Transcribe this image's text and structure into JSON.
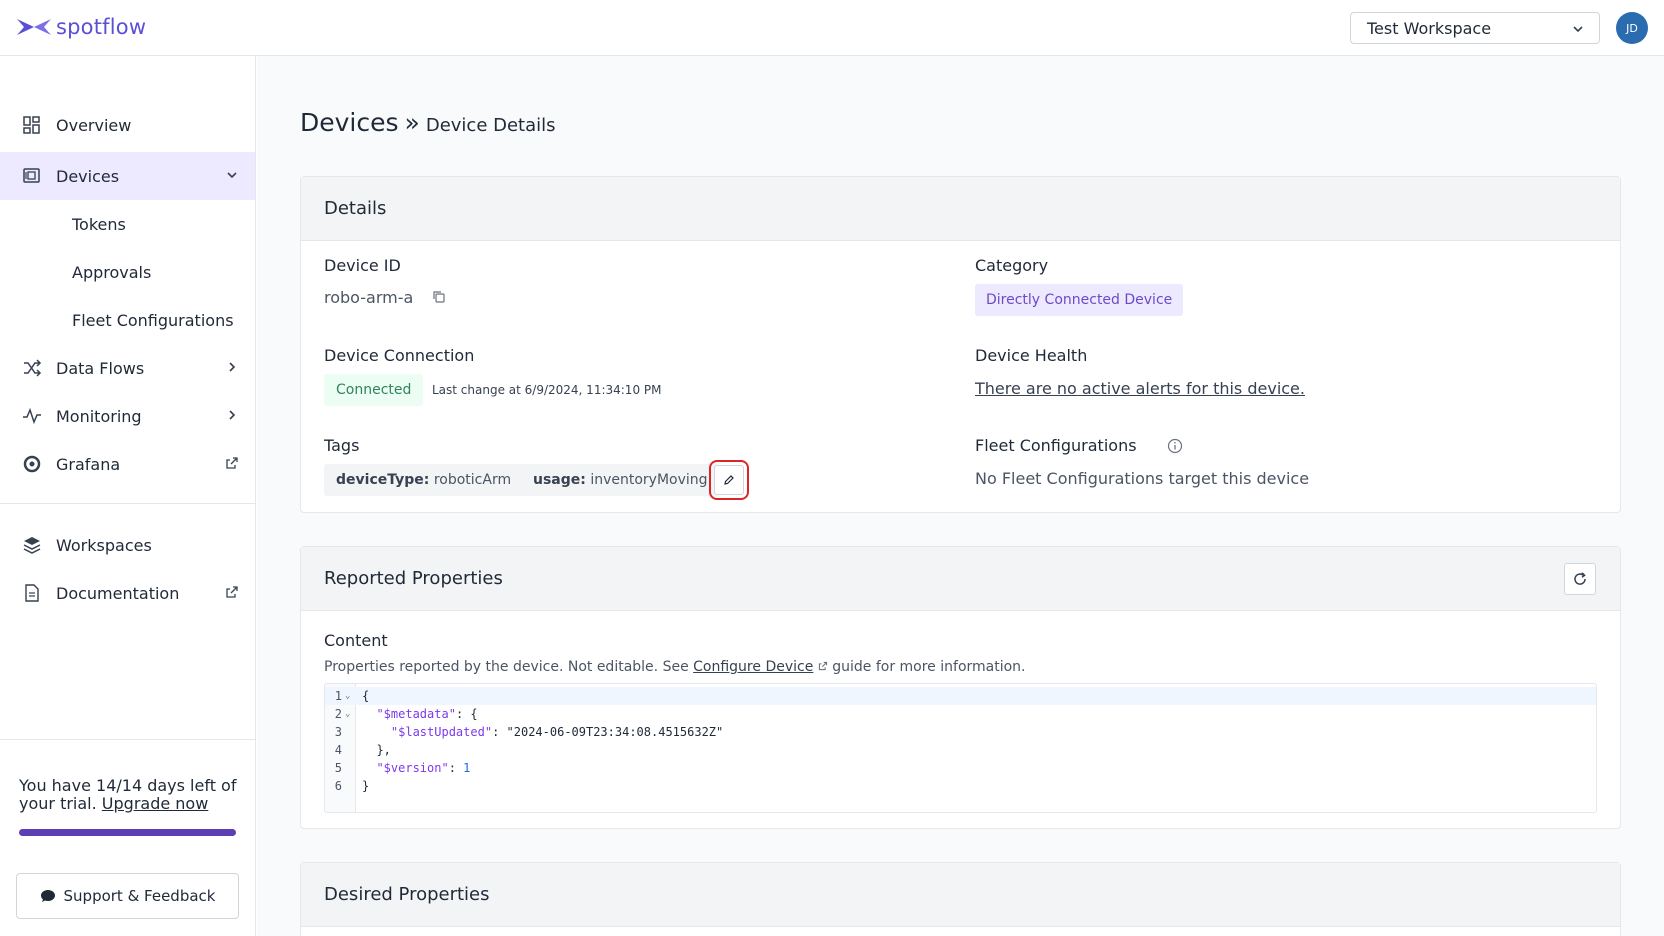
{
  "app": {
    "logo_text": "spotflow"
  },
  "header": {
    "workspace_selected": "Test Workspace",
    "avatar_initials": "JD"
  },
  "sidebar": {
    "items": [
      {
        "label": "Overview"
      },
      {
        "label": "Devices"
      },
      {
        "label": "Tokens"
      },
      {
        "label": "Approvals"
      },
      {
        "label": "Fleet Configurations"
      },
      {
        "label": "Data Flows"
      },
      {
        "label": "Monitoring"
      },
      {
        "label": "Grafana"
      },
      {
        "label": "Workspaces"
      },
      {
        "label": "Documentation"
      }
    ],
    "trial_text": "You have 14/14 days left of your trial.",
    "upgrade_link": "Upgrade now",
    "trial_progress": 1.0,
    "support_label": "Support & Feedback"
  },
  "breadcrumb": {
    "root": "Devices",
    "separator": "»",
    "current": "Device Details"
  },
  "details": {
    "title": "Details",
    "device_id_label": "Device ID",
    "device_id": "robo-arm-a",
    "category_label": "Category",
    "category": "Directly Connected Device",
    "connection_label": "Device Connection",
    "connection_status": "Connected",
    "last_change": "Last change at 6/9/2024, 11:34:10 PM",
    "health_label": "Device Health",
    "health_text": "There are no active alerts for this device.",
    "tags_label": "Tags",
    "tags": [
      {
        "key": "deviceType:",
        "value": "roboticArm"
      },
      {
        "key": "usage:",
        "value": "inventoryMoving"
      }
    ],
    "fleet_label": "Fleet Configurations",
    "fleet_text": "No Fleet Configurations target this device"
  },
  "reported": {
    "title": "Reported Properties",
    "content_label": "Content",
    "desc_before": "Properties reported by the device. Not editable. See",
    "desc_link": "Configure Device",
    "desc_after": "guide for more information.",
    "lines": [
      {
        "num": "1",
        "fold": true
      },
      {
        "num": "2",
        "fold": true
      },
      {
        "num": "3",
        "fold": false
      },
      {
        "num": "4",
        "fold": false
      },
      {
        "num": "5",
        "fold": false
      },
      {
        "num": "6",
        "fold": false
      }
    ],
    "code": {
      "l1": "{",
      "l2_key": "\"$metadata\"",
      "l2_rest": ": {",
      "l3_key": "\"$lastUpdated\"",
      "l3_colon": ": ",
      "l3_val": "\"2024-06-09T23:34:08.4515632Z\"",
      "l4": "},",
      "l5_key": "\"$version\"",
      "l5_colon": ": ",
      "l5_val": "1",
      "l6": "}"
    }
  },
  "desired": {
    "title": "Desired Properties"
  },
  "colors": {
    "accent": "#5b4fd6",
    "active_nav": "#ede9fe",
    "connected": "#2f855a",
    "highlight": "#dc2626"
  }
}
